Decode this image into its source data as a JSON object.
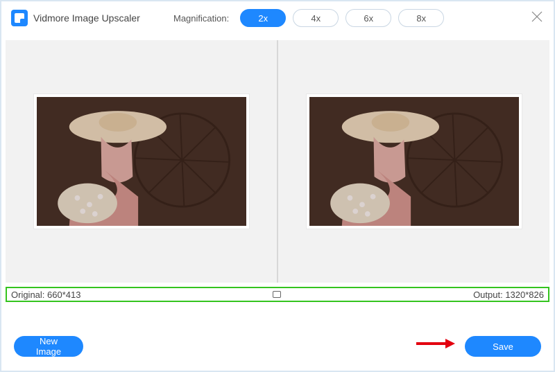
{
  "app": {
    "title": "Vidmore Image Upscaler"
  },
  "magnification": {
    "label": "Magnification:",
    "options": [
      "2x",
      "4x",
      "6x",
      "8x"
    ],
    "active": "2x"
  },
  "dimensions": {
    "original_label": "Original:",
    "original_value": "660*413",
    "output_label": "Output:",
    "output_value": "1320*826"
  },
  "buttons": {
    "new_image": "New Image",
    "save": "Save"
  },
  "icons": {
    "close": "close-icon",
    "logo": "vidmore-logo",
    "arrow": "red-arrow"
  },
  "colors": {
    "accent": "#1e88ff",
    "highlight_border": "#34c41e",
    "arrow": "#e3000f"
  }
}
